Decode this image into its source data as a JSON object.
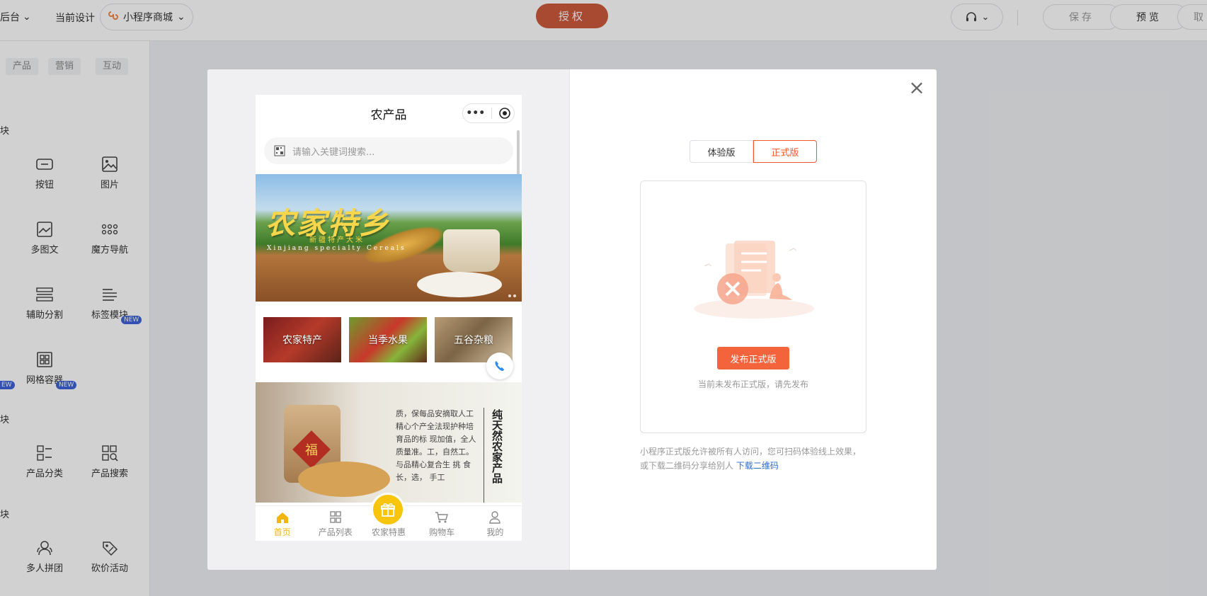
{
  "topbar": {
    "backend_label": "后台",
    "current_design_label": "当前设计",
    "design_select": "小程序商城",
    "auth_label": "授权",
    "save_label": "保存",
    "preview_label": "预览",
    "cancel_label": "取"
  },
  "left_panel": {
    "tabs": [
      "产品",
      "营销",
      "互动"
    ],
    "section_marks": [
      "块",
      "块",
      "块"
    ],
    "components": {
      "button": "按钮",
      "image": "图片",
      "multi_image_text": "多图文",
      "magic_nav": "魔方导航",
      "divider": "辅助分割",
      "tag_module": "标签模块",
      "grid_container": "网格容器",
      "product_category": "产品分类",
      "product_search": "产品搜索",
      "group_buy": "多人拼团",
      "bargain": "砍价活动"
    },
    "new_badge": "NEW",
    "new_badge_partial": "EW"
  },
  "phone": {
    "title": "农产品",
    "search_placeholder": "请输入关键词搜索...",
    "banner": {
      "title": "农家特乡",
      "subtitle": "新疆特产大米",
      "english": "Xinjiang specialty Cereals"
    },
    "categories": [
      "农家特产",
      "当季水果",
      "五谷杂粮"
    ],
    "feature": {
      "fu": "福",
      "paragraph": "质，保每品安摘取人工精心个产全法现护种培育品的标 现加值，全人质量准。工，自然工。与品精心复合生 挑 食 长，选， 手工",
      "vertical_title": "纯天然农家产品"
    },
    "tabbar": [
      {
        "label": "首页",
        "icon": "home-icon",
        "active": true
      },
      {
        "label": "产品列表",
        "icon": "grid-icon",
        "active": false
      },
      {
        "label": "农家特惠",
        "icon": "gift-icon",
        "active": false
      },
      {
        "label": "购物车",
        "icon": "cart-icon",
        "active": false
      },
      {
        "label": "我的",
        "icon": "user-icon",
        "active": false
      }
    ]
  },
  "publish": {
    "trial_label": "体验版",
    "official_label": "正式版",
    "publish_button": "发布正式版",
    "not_published_text": "当前未发布正式版，请先发布",
    "description": "小程序正式版允许被所有人访问，您可扫码体验线上效果，或下载二维码分享给别人",
    "download_link": "下载二维码"
  },
  "colors": {
    "accent": "#f3643c",
    "auth_button": "#cc5b3c",
    "tab_active": "#f4b50b",
    "link": "#2d6ccf",
    "new_badge": "#3d63d8"
  }
}
